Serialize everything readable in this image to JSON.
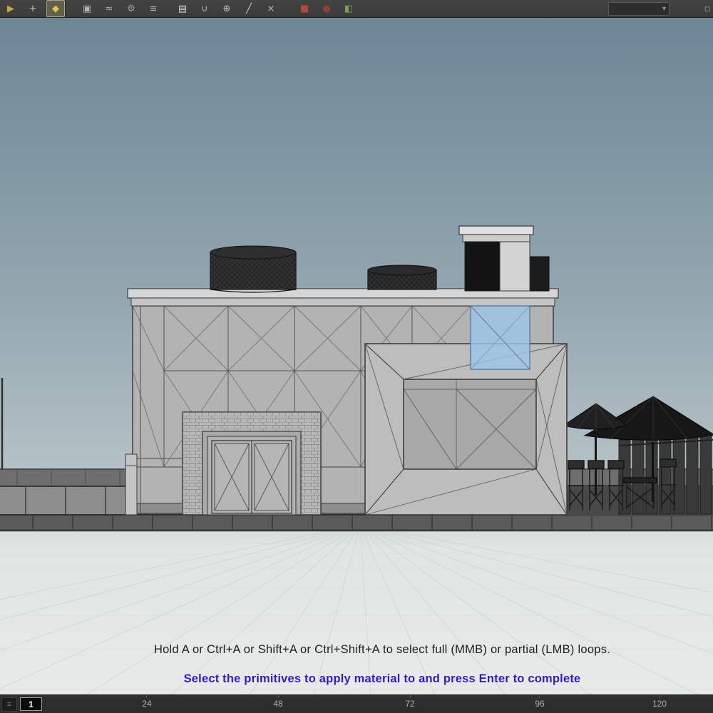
{
  "toolbar": {
    "icons": [
      {
        "name": "select-mode-icon",
        "glyph": "▶",
        "color": "#c9a53c"
      },
      {
        "name": "translate-handle-icon",
        "glyph": "+",
        "color": "#bfbfbf"
      },
      {
        "name": "active-tool-icon",
        "glyph": "◆",
        "color": "#e3c342"
      },
      {
        "name": "edit-mode-icon",
        "glyph": "▣",
        "color": "#b5b5b5"
      },
      {
        "name": "soft-edit-icon",
        "glyph": "≈",
        "color": "#b5b5b5"
      },
      {
        "name": "wrench-tool-icon",
        "glyph": "⚙",
        "color": "#a0a0a0"
      },
      {
        "name": "loop-select-icon",
        "glyph": "≡",
        "color": "#b0b0b0"
      },
      {
        "name": "ruler-tool-icon",
        "glyph": "▤",
        "color": "#d6d6d6"
      },
      {
        "name": "magnet-snap-icon",
        "glyph": "∪",
        "color": "#b0b0b0"
      },
      {
        "name": "add-point-icon",
        "glyph": "⊕",
        "color": "#c2c2c2"
      },
      {
        "name": "knife-tool-icon",
        "glyph": "╱",
        "color": "#cdcdcd"
      },
      {
        "name": "delete-tool-icon",
        "glyph": "×",
        "color": "#b5b5b5"
      },
      {
        "name": "material-palette-icon",
        "glyph": "■",
        "color": "#b34a36"
      },
      {
        "name": "sphere-primitive-icon",
        "glyph": "●",
        "color": "#8a4434"
      },
      {
        "name": "uv-view-icon",
        "glyph": "◧",
        "color": "#7fa05a"
      },
      {
        "name": "extra-tool-icon",
        "glyph": "▫",
        "color": "#9a9a9a"
      }
    ],
    "menu": {
      "glyph": "▾"
    }
  },
  "viewport": {
    "help_text": "Hold A or Ctrl+A or Shift+A or Ctrl+Shift+A to select full (MMB) or partial (LMB) loops.",
    "prompt_text": "Select the primitives to apply material to and press Enter to complete"
  },
  "timeline": {
    "menu_glyph": "≡",
    "current_frame": "1",
    "ticks": [
      "24",
      "48",
      "72",
      "96",
      "120"
    ]
  },
  "colors": {
    "prompt_blue": "#2b1ae2",
    "help_text": "#202020",
    "selected_primitive_blue": "#9cc6e8",
    "sky_top": "#6d8695",
    "sky_mid": "#93a7b0",
    "sky_bottom": "#c0cbcd",
    "ground": "#e0e6e3",
    "toolbar_bg": "#3b3b3b",
    "timeline_bg": "#2b2b2b"
  }
}
